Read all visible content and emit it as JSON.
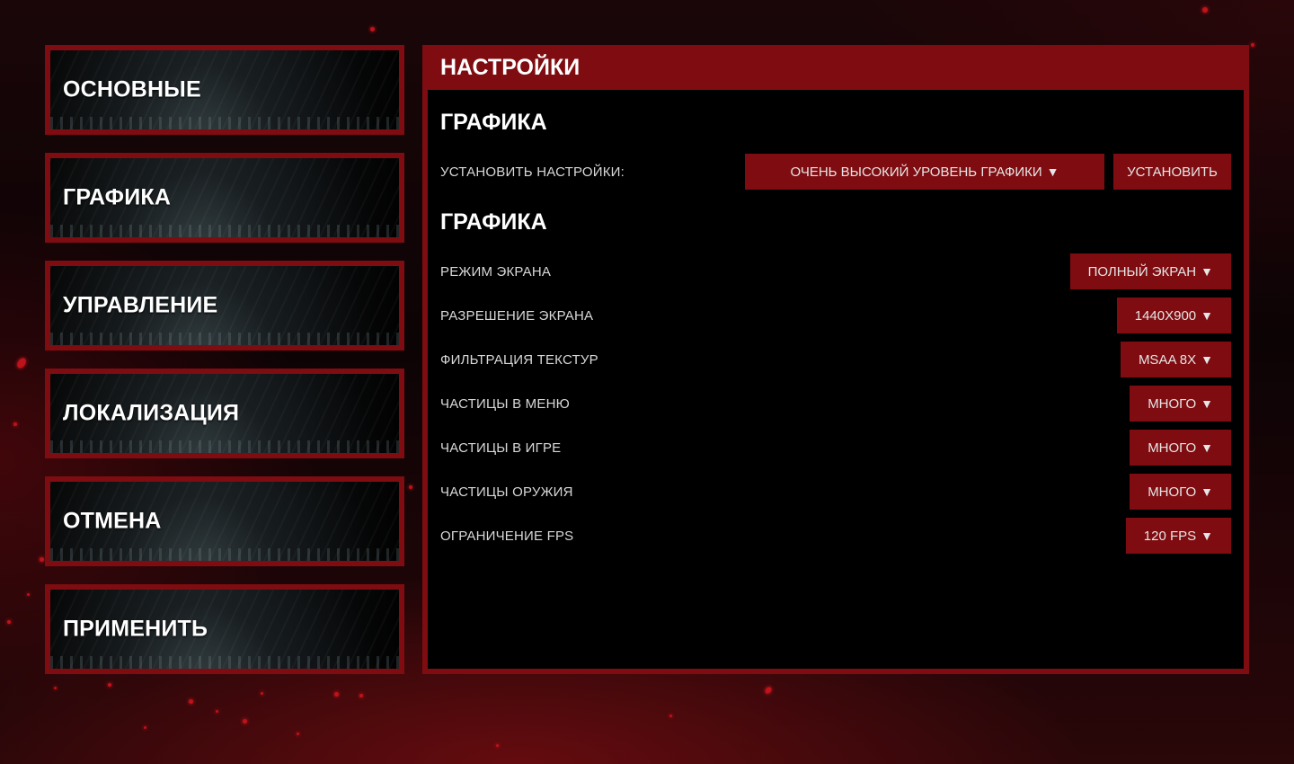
{
  "menu": {
    "items": [
      {
        "label": "ОСНОВНЫЕ"
      },
      {
        "label": "ГРАФИКА"
      },
      {
        "label": "УПРАВЛЕНИЕ"
      },
      {
        "label": "ЛОКАЛИЗАЦИЯ"
      },
      {
        "label": "ОТМЕНА"
      },
      {
        "label": "ПРИМЕНИТЬ"
      }
    ]
  },
  "panel": {
    "title": "НАСТРОЙКИ",
    "preset_section": "ГРАФИКА",
    "preset_label": "УСТАНОВИТЬ НАСТРОЙКИ:",
    "preset_value": "ОЧЕНЬ ВЫСОКИЙ УРОВЕНЬ ГРАФИКИ",
    "apply_label": "УСТАНОВИТЬ",
    "graphics_section": "ГРАФИКА",
    "rows": [
      {
        "label": "РЕЖИМ ЭКРАНА",
        "value": "ПОЛНЫЙ ЭКРАН"
      },
      {
        "label": "РАЗРЕШЕНИЕ ЭКРАНА",
        "value": "1440X900"
      },
      {
        "label": "ФИЛЬТРАЦИЯ ТЕКСТУР",
        "value": "MSAA 8X"
      },
      {
        "label": "ЧАСТИЦЫ В МЕНЮ",
        "value": "МНОГО"
      },
      {
        "label": "ЧАСТИЦЫ В ИГРЕ",
        "value": "МНОГО"
      },
      {
        "label": "ЧАСТИЦЫ ОРУЖИЯ",
        "value": "МНОГО"
      },
      {
        "label": "ОГРАНИЧЕНИЕ FPS",
        "value": "120 FPS"
      }
    ],
    "caret_glyph": "▼"
  },
  "colors": {
    "accent": "#7e0c10",
    "panel_bg": "#000000"
  }
}
